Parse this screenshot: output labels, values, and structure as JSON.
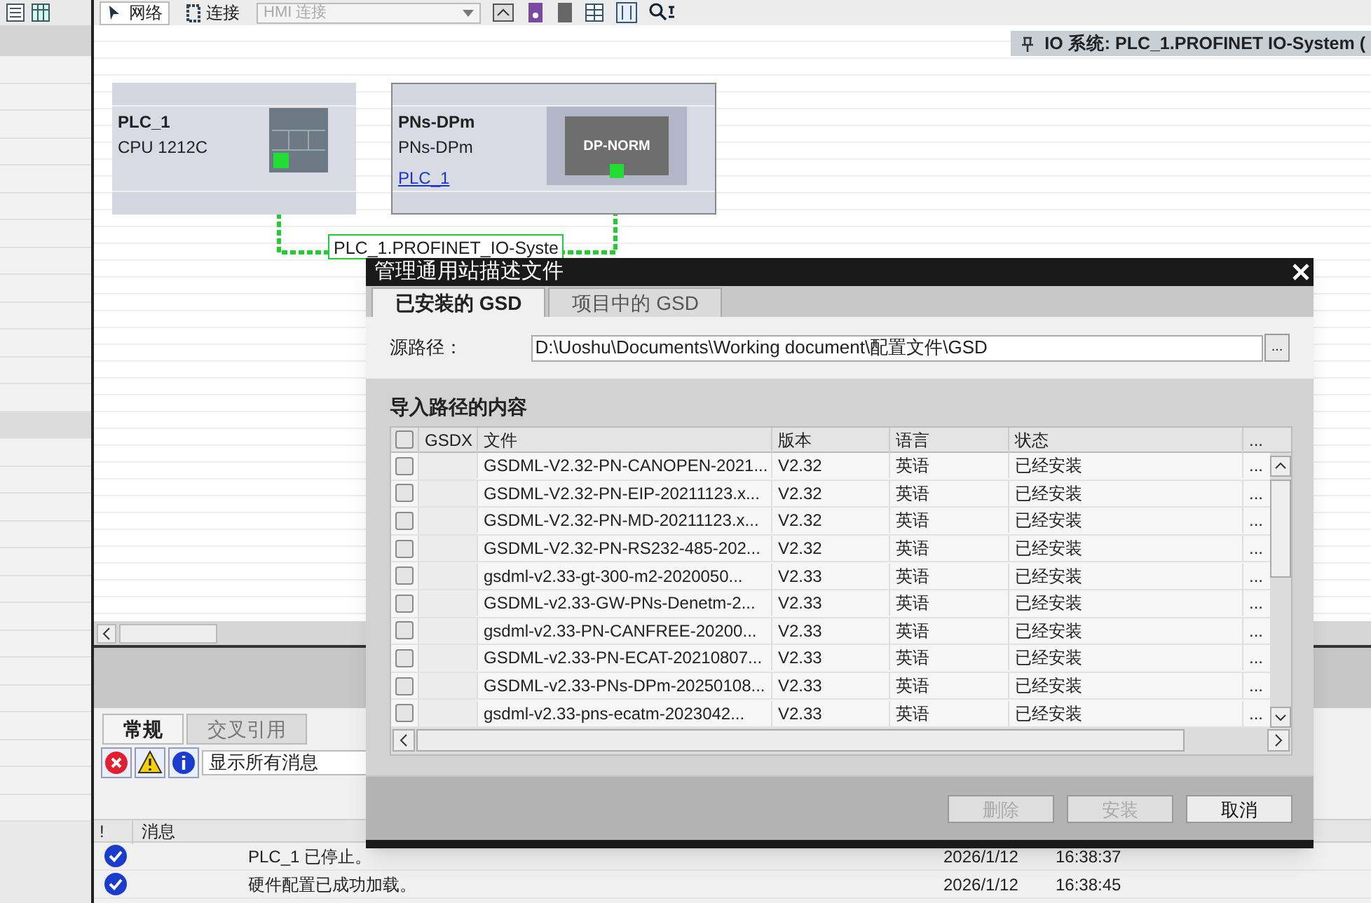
{
  "toolbar": {
    "network_button": "网络",
    "connect_button": "连接",
    "connection_dropdown": "HMI 连接"
  },
  "io_system_banner": "IO 系统: PLC_1.PROFINET IO-System (",
  "devices": [
    {
      "name": "PLC_1",
      "type": "CPU 1212C"
    },
    {
      "name": "PNs-DPm",
      "type": "PNs-DPm",
      "link": "PLC_1",
      "module_label": "DP-NORM"
    }
  ],
  "network_label": "PLC_1.PROFINET_IO-Syste",
  "inspector": {
    "tabs": [
      {
        "label": "常规",
        "selected": true
      },
      {
        "label": "交叉引用",
        "selected": false
      }
    ],
    "filter": "显示所有消息",
    "columns": [
      "!",
      "消息"
    ],
    "messages": [
      {
        "text": "PLC_1 已停止。",
        "date": "2026/1/12",
        "time": "16:38:37"
      },
      {
        "text": "硬件配置已成功加载。",
        "date": "2026/1/12",
        "time": "16:38:45"
      }
    ]
  },
  "dialog": {
    "title": "管理通用站描述文件",
    "tabs": [
      {
        "label": "已安装的 GSD",
        "selected": true
      },
      {
        "label": "项目中的 GSD",
        "selected": false
      }
    ],
    "source_label": "源路径：",
    "source_path": "D:\\Uoshu\\Documents\\Working document\\配置文件\\GSD",
    "browse": "...",
    "section_title": "导入路径的内容",
    "header_checked": false,
    "columns": [
      "GSDX",
      "文件",
      "版本",
      "语言",
      "状态",
      "..."
    ],
    "rows": [
      {
        "checked": false,
        "file": "GSDML-V2.32-PN-CANOPEN-2021...",
        "version": "V2.32",
        "language": "英语",
        "status": "已经安装",
        "more": "..."
      },
      {
        "checked": false,
        "file": "GSDML-V2.32-PN-EIP-20211123.x...",
        "version": "V2.32",
        "language": "英语",
        "status": "已经安装",
        "more": "..."
      },
      {
        "checked": false,
        "file": "GSDML-V2.32-PN-MD-20211123.x...",
        "version": "V2.32",
        "language": "英语",
        "status": "已经安装",
        "more": "..."
      },
      {
        "checked": false,
        "file": "GSDML-V2.32-PN-RS232-485-202...",
        "version": "V2.32",
        "language": "英语",
        "status": "已经安装",
        "more": "..."
      },
      {
        "checked": false,
        "file": "gsdml-v2.33-gt-300-m2-2020050...",
        "version": "V2.33",
        "language": "英语",
        "status": "已经安装",
        "more": "..."
      },
      {
        "checked": false,
        "file": "GSDML-v2.33-GW-PNs-Denetm-2...",
        "version": "V2.33",
        "language": "英语",
        "status": "已经安装",
        "more": "..."
      },
      {
        "checked": false,
        "file": "gsdml-v2.33-PN-CANFREE-20200...",
        "version": "V2.33",
        "language": "英语",
        "status": "已经安装",
        "more": "..."
      },
      {
        "checked": false,
        "file": "GSDML-v2.33-PN-ECAT-20210807...",
        "version": "V2.33",
        "language": "英语",
        "status": "已经安装",
        "more": "..."
      },
      {
        "checked": false,
        "file": "GSDML-v2.33-PNs-DPm-20250108...",
        "version": "V2.33",
        "language": "英语",
        "status": "已经安装",
        "more": "..."
      },
      {
        "checked": false,
        "file": "gsdml-v2.33-pns-ecatm-2023042...",
        "version": "V2.33",
        "language": "英语",
        "status": "已经安装",
        "more": "..."
      }
    ],
    "buttons": [
      {
        "label": "删除",
        "disabled": true
      },
      {
        "label": "安装",
        "disabled": true
      },
      {
        "label": "取消",
        "disabled": false
      }
    ]
  }
}
